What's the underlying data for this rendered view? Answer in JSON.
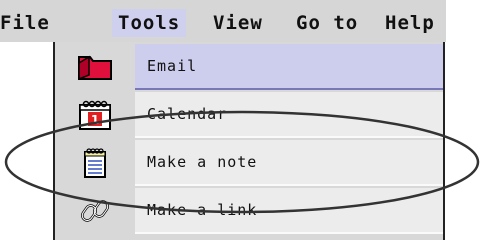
{
  "menubar": {
    "items": [
      {
        "label": "File"
      },
      {
        "label": "Tools"
      },
      {
        "label": "View"
      },
      {
        "label": "Go to"
      },
      {
        "label": "Help"
      }
    ],
    "active_index": 1
  },
  "dropdown": {
    "items": [
      {
        "label": "Email",
        "icon": "email-folder-icon",
        "selected": true
      },
      {
        "label": "Calendar",
        "icon": "calendar-icon",
        "selected": false
      },
      {
        "label": "Make a note",
        "icon": "notepad-icon",
        "selected": false
      },
      {
        "label": "Make a link",
        "icon": "link-icon",
        "selected": false
      }
    ]
  },
  "colors": {
    "menubar_bg": "#d6d6d6",
    "active_menu_bg": "#cfcfee",
    "selected_item_bg": "#cdcdee",
    "item_bg": "#ececec",
    "email_icon": "#e0103c",
    "calendar_day": "#e02020"
  },
  "calendar_icon_day": "1",
  "annotation": {
    "shape": "ellipse",
    "highlights": "Make a note"
  }
}
